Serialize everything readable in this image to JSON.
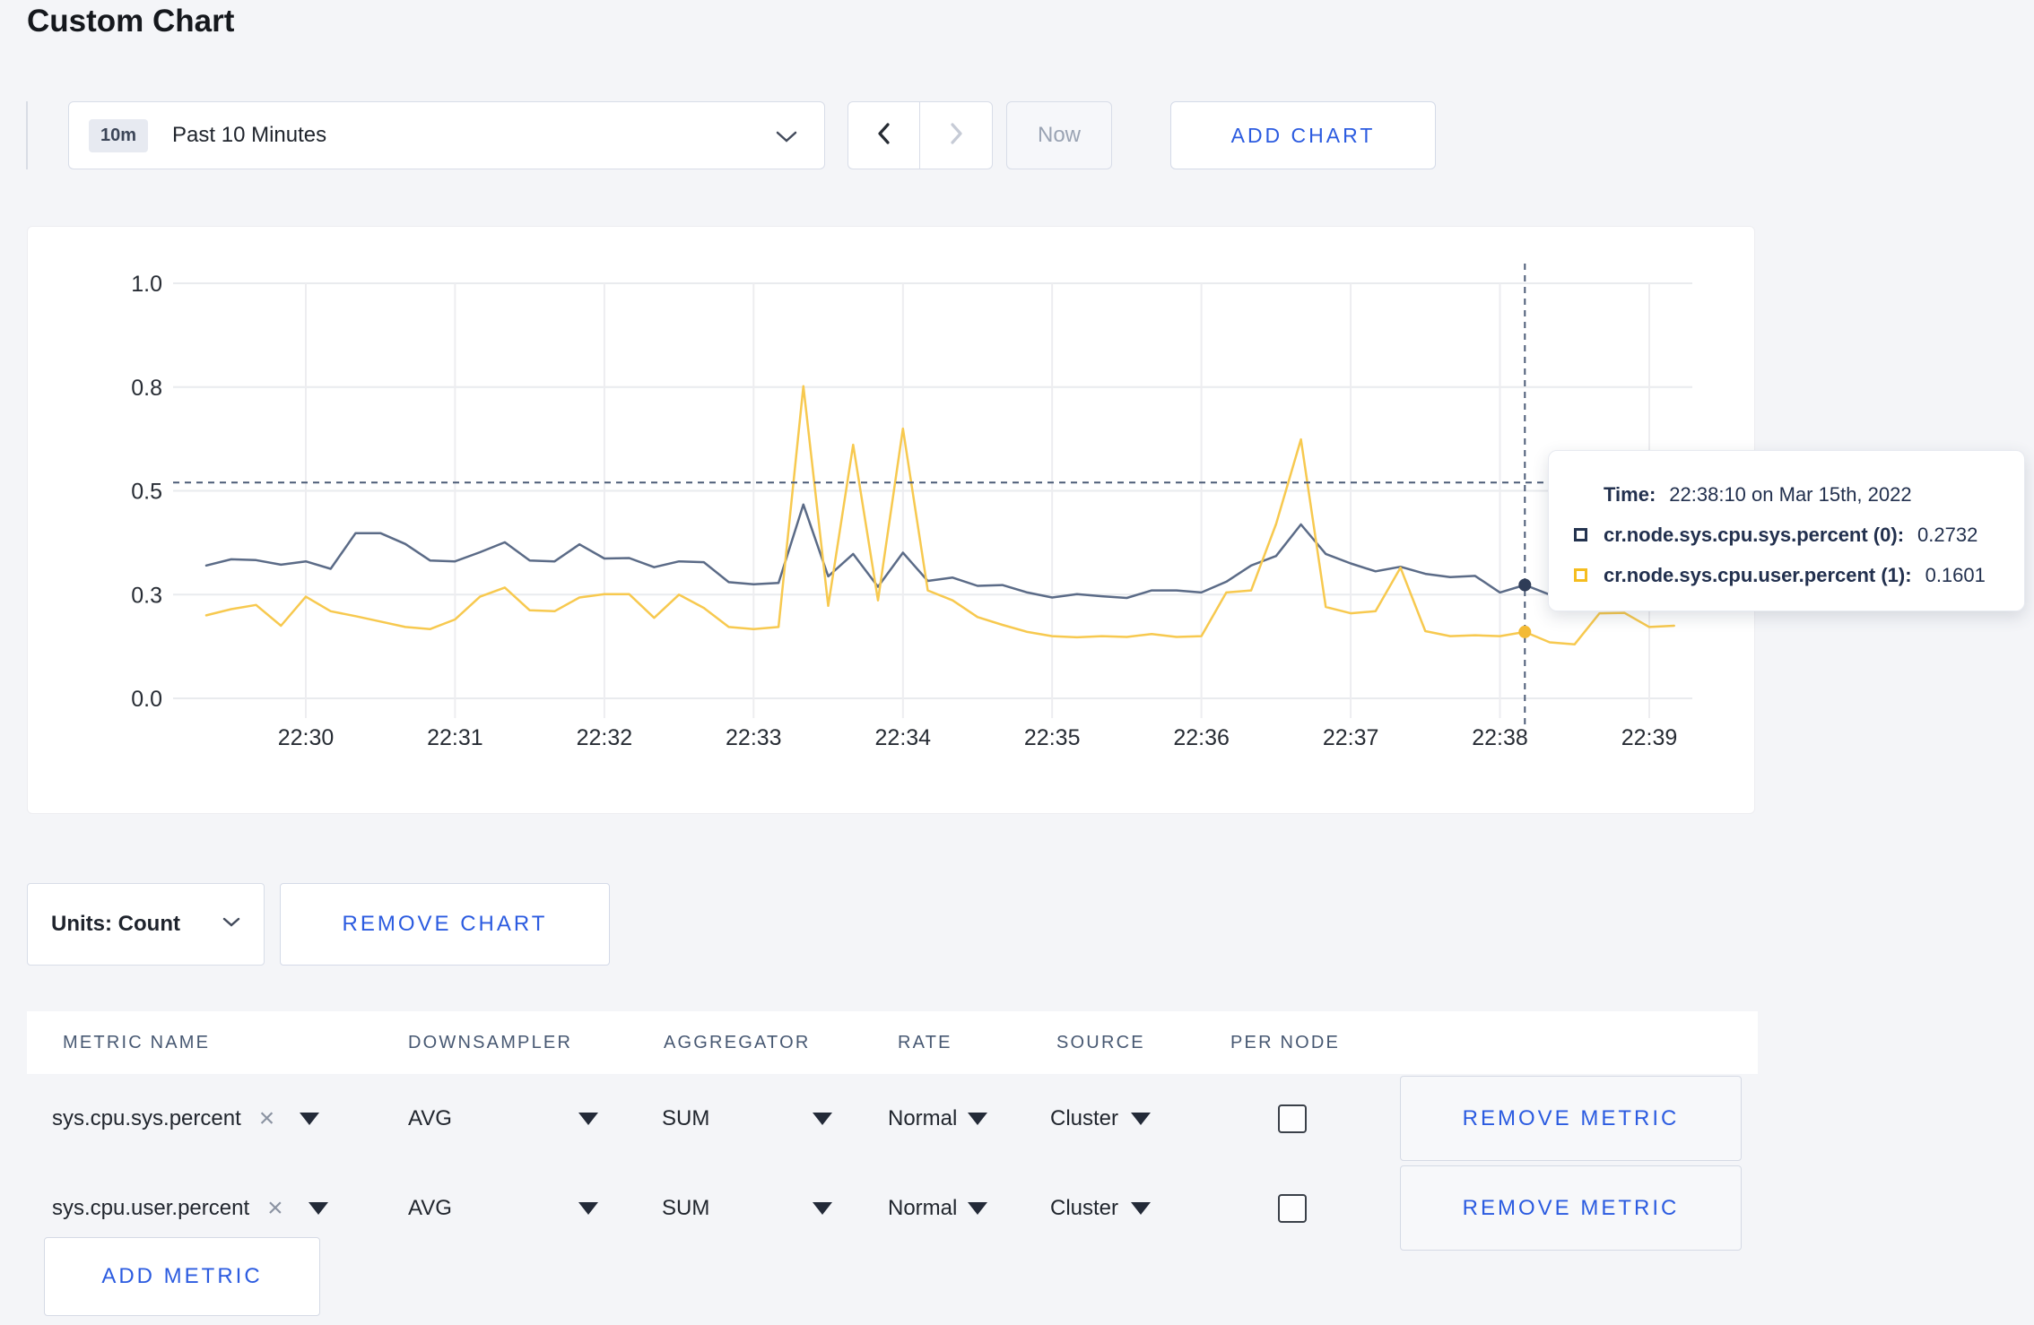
{
  "page": {
    "title": "Custom Chart"
  },
  "toolbar": {
    "time_badge": "10m",
    "time_label": "Past 10 Minutes",
    "now_label": "Now",
    "add_chart_label": "ADD CHART"
  },
  "chart_data": {
    "type": "line",
    "title": "",
    "xlabel": "",
    "ylabel": "",
    "grid": true,
    "legend_position": "tooltip",
    "x_axis": {
      "tick_labels": [
        "22:30",
        "22:31",
        "22:32",
        "22:33",
        "22:34",
        "22:35",
        "22:36",
        "22:37",
        "22:38",
        "22:39"
      ],
      "start_time": "22:29:20",
      "start_offset_seconds": -40,
      "interval_seconds": 10
    },
    "y_axis": {
      "tick_labels": [
        "0.0",
        "0.3",
        "0.5",
        "0.8",
        "1.0"
      ],
      "tick_values": [
        0,
        0.25,
        0.5,
        0.75,
        1.0
      ],
      "range": [
        0,
        1
      ]
    },
    "series": [
      {
        "name": "cr.node.sys.cpu.sys.percent (0)",
        "color": "#5b6b87",
        "marker_color": "#2e3c57",
        "values": [
          0.32,
          0.335,
          0.333,
          0.322,
          0.33,
          0.312,
          0.398,
          0.398,
          0.372,
          0.332,
          0.33,
          0.352,
          0.376,
          0.332,
          0.33,
          0.371,
          0.337,
          0.338,
          0.316,
          0.33,
          0.328,
          0.28,
          0.275,
          0.278,
          0.467,
          0.294,
          0.348,
          0.269,
          0.351,
          0.283,
          0.291,
          0.271,
          0.273,
          0.255,
          0.243,
          0.251,
          0.246,
          0.242,
          0.26,
          0.26,
          0.255,
          0.281,
          0.32,
          0.343,
          0.419,
          0.348,
          0.325,
          0.306,
          0.317,
          0.3,
          0.292,
          0.295,
          0.255,
          0.2732,
          0.25,
          0.26,
          0.27,
          0.265,
          0.262,
          0.27
        ]
      },
      {
        "name": "cr.node.sys.cpu.user.percent (1)",
        "color": "#f7c94f",
        "marker_color": "#f3ba35",
        "values": [
          0.2,
          0.215,
          0.225,
          0.175,
          0.245,
          0.21,
          0.198,
          0.185,
          0.172,
          0.167,
          0.19,
          0.245,
          0.267,
          0.212,
          0.21,
          0.243,
          0.251,
          0.251,
          0.194,
          0.25,
          0.218,
          0.172,
          0.167,
          0.172,
          0.752,
          0.223,
          0.611,
          0.236,
          0.65,
          0.26,
          0.236,
          0.196,
          0.177,
          0.16,
          0.15,
          0.147,
          0.15,
          0.148,
          0.155,
          0.148,
          0.15,
          0.255,
          0.26,
          0.42,
          0.624,
          0.22,
          0.205,
          0.21,
          0.315,
          0.162,
          0.15,
          0.152,
          0.15,
          0.1601,
          0.135,
          0.13,
          0.205,
          0.206,
          0.172,
          0.175
        ]
      }
    ],
    "crosshair": {
      "index": 53,
      "time": "22:38:10",
      "y_value": 0.52
    },
    "tooltip": {
      "time_label": "Time:",
      "time_value": "22:38:10 on Mar 15th, 2022",
      "rows": [
        {
          "label": "cr.node.sys.cpu.sys.percent (0):",
          "value": "0.2732",
          "color": "#24334f"
        },
        {
          "label": "cr.node.sys.cpu.user.percent (1):",
          "value": "0.1601",
          "color": "#f5bd1f"
        }
      ]
    }
  },
  "units_bar": {
    "units_label": "Units: Count",
    "remove_chart_label": "REMOVE CHART"
  },
  "metrics_table": {
    "headers": [
      "METRIC NAME",
      "DOWNSAMPLER",
      "AGGREGATOR",
      "RATE",
      "SOURCE",
      "PER NODE"
    ],
    "rows": [
      {
        "metric": "sys.cpu.sys.percent",
        "downsampler": "AVG",
        "aggregator": "SUM",
        "rate": "Normal",
        "source": "Cluster",
        "per_node_checked": false,
        "remove_label": "REMOVE METRIC"
      },
      {
        "metric": "sys.cpu.user.percent",
        "downsampler": "AVG",
        "aggregator": "SUM",
        "rate": "Normal",
        "source": "Cluster",
        "per_node_checked": false,
        "remove_label": "REMOVE METRIC"
      }
    ],
    "add_metric_label": "ADD METRIC"
  },
  "colors": {
    "accent_blue": "#2b5be0",
    "page_bg": "#f4f5f8",
    "grid_line": "#e9ebee",
    "crosshair": "#4c5c77"
  }
}
